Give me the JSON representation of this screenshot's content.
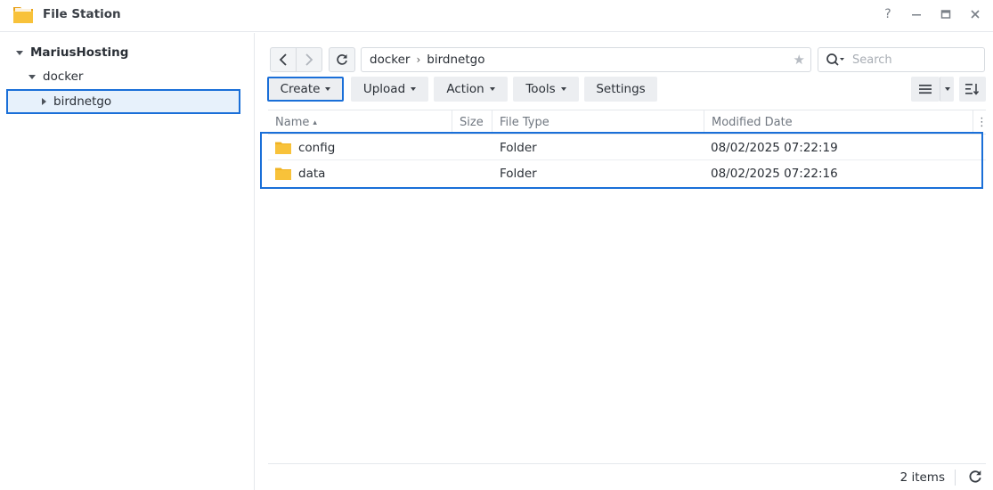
{
  "window": {
    "title": "File Station",
    "controls": {
      "help": "?",
      "minimize": "—",
      "maximize": "▭",
      "close": "✕"
    }
  },
  "sidebar": {
    "root": "MariusHosting",
    "folder": "docker",
    "subfolder": "birdnetgo"
  },
  "path": {
    "segments": [
      "docker",
      "birdnetgo"
    ],
    "separator": "›"
  },
  "search": {
    "placeholder": "Search"
  },
  "toolbar": {
    "create": "Create",
    "upload": "Upload",
    "action": "Action",
    "tools": "Tools",
    "settings": "Settings"
  },
  "columns": {
    "name": "Name",
    "sort_indicator": "▴",
    "size": "Size",
    "file_type": "File Type",
    "modified": "Modified Date",
    "more": "⋮"
  },
  "files": [
    {
      "name": "config",
      "size": "",
      "type": "Folder",
      "modified": "08/02/2025 07:22:19"
    },
    {
      "name": "data",
      "size": "",
      "type": "Folder",
      "modified": "08/02/2025 07:22:16"
    }
  ],
  "status": {
    "count": "2 items"
  },
  "colors": {
    "accent": "#1a6fd8",
    "folder": "#f8c23a",
    "selected_bg": "#e7f1fb"
  }
}
